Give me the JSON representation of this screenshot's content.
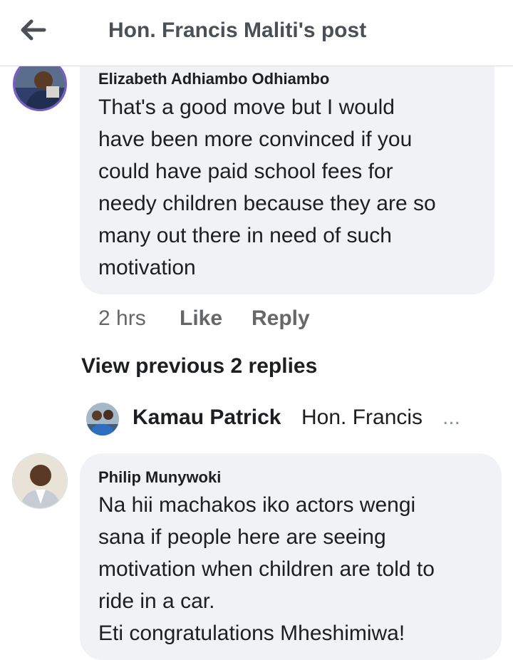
{
  "header": {
    "title": "Hon. Francis Maliti's post",
    "back_icon": "arrow-left-icon"
  },
  "comments": [
    {
      "author": "Elizabeth Adhiambo Odhiambo",
      "text": "That's a good move but I would\nhave been more convinced if you\ncould have paid school fees for\nneedy children because they are so\nmany out there in need of such\nmotivation",
      "time": "2 hrs",
      "like_label": "Like",
      "reply_label": "Reply"
    },
    {
      "author": "Philip Munywoki",
      "text": "Na hii machakos iko actors wengi\nsana if people here are seeing\nmotivation when children are told to\nride in a car.\nEti congratulations Mheshimiwa!"
    }
  ],
  "thread": {
    "view_previous_label": "View previous 2 replies",
    "reply_author": "Kamau Patrick",
    "reply_snippet": "Hon. Francis",
    "reply_ellipsis": "..."
  },
  "colors": {
    "bubble": "#f0f2f5",
    "meta_text": "#65676b",
    "header_text": "#4b4f56"
  }
}
